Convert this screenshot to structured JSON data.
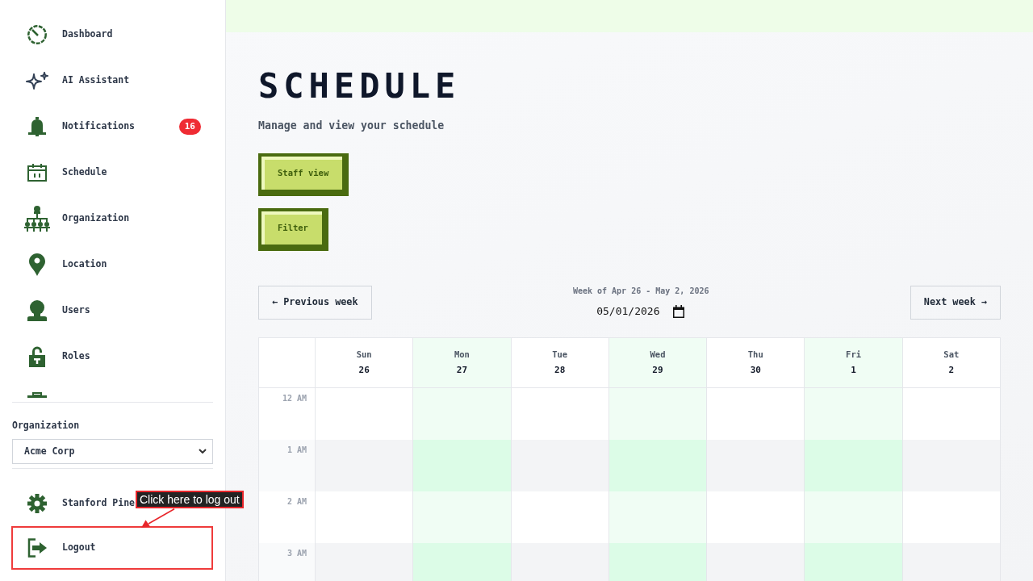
{
  "sidebar": {
    "nav_items": [
      {
        "label": "Dashboard"
      },
      {
        "label": "AI Assistant"
      },
      {
        "label": "Notifications",
        "badge": "16"
      },
      {
        "label": "Schedule"
      },
      {
        "label": "Organization"
      },
      {
        "label": "Location"
      },
      {
        "label": "Users"
      },
      {
        "label": "Roles"
      }
    ],
    "nav_clipped_item": true,
    "organization": {
      "label": "Organization",
      "value": "Acme Corp"
    },
    "footer_items": [
      {
        "label": "Stanford Pine",
        "highlighted": false
      },
      {
        "label": "Logout",
        "highlighted": true
      }
    ]
  },
  "annotation": {
    "text": "Click here to log out"
  },
  "page": {
    "title": "SCHEDULE",
    "subtitle": "Manage and view your schedule",
    "actions": [
      "Staff view",
      "Filter"
    ]
  },
  "week_nav": {
    "previous": "← Previous week",
    "range": "Week of Apr 26 - May 2, 2026",
    "date": "05/01/2026",
    "next": "Next week →"
  },
  "calendar": {
    "days": [
      {
        "name": "Sun",
        "date": "26",
        "shaded": false
      },
      {
        "name": "Mon",
        "date": "27",
        "shaded": true
      },
      {
        "name": "Tue",
        "date": "28",
        "shaded": false
      },
      {
        "name": "Wed",
        "date": "29",
        "shaded": true
      },
      {
        "name": "Thu",
        "date": "30",
        "shaded": false
      },
      {
        "name": "Fri",
        "date": "1",
        "shaded": true
      },
      {
        "name": "Sat",
        "date": "2",
        "shaded": false
      }
    ],
    "hours": [
      "12 AM",
      "1 AM",
      "2 AM",
      "3 AM"
    ]
  }
}
